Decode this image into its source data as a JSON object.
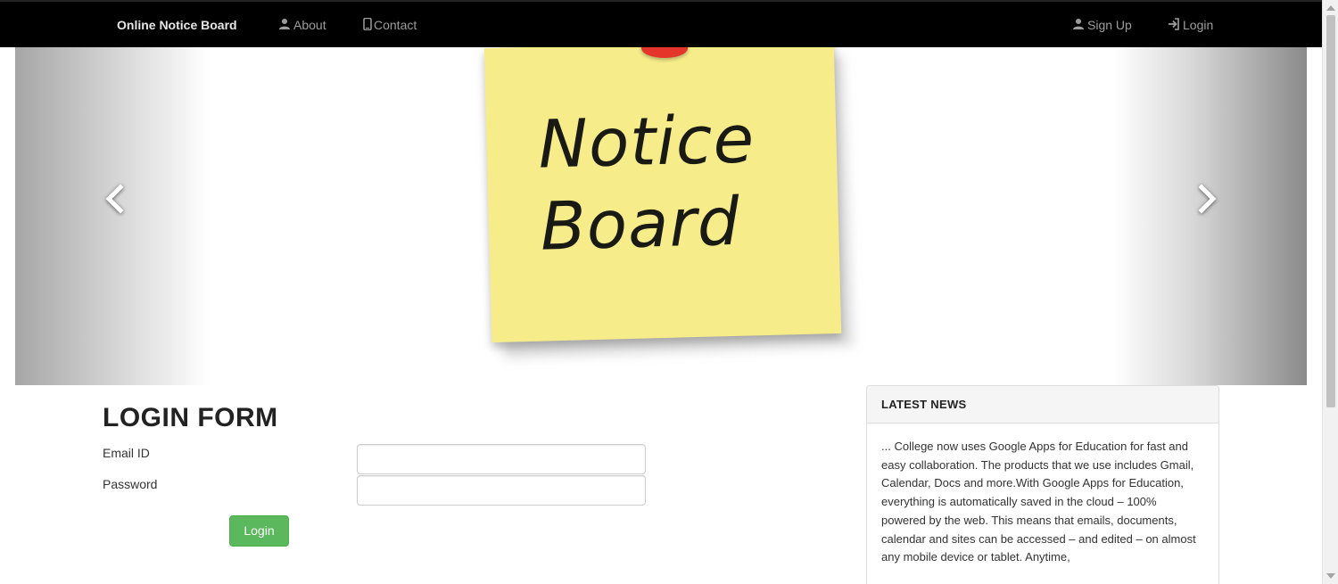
{
  "navbar": {
    "brand": "Online Notice Board",
    "about_label": "About",
    "contact_label": "Contact",
    "signup_label": "Sign Up",
    "login_label": "Login",
    "icons": {
      "about": "user-icon",
      "contact": "mobile-phone-icon",
      "signup": "user-icon",
      "login": "log-in-icon"
    }
  },
  "carousel": {
    "sticky_line1": "Notice",
    "sticky_line2": "Board",
    "prev_icon": "chevron-left-icon",
    "next_icon": "chevron-right-icon",
    "note_color": "#f7ec8a",
    "pin_color": "#e5342a"
  },
  "login_form": {
    "title": "LOGIN FORM",
    "email_label": "Email ID",
    "email_value": "",
    "password_label": "Password",
    "password_value": "",
    "submit_label": "Login",
    "submit_color": "#5cb85c"
  },
  "news": {
    "heading": "LATEST NEWS",
    "body": "... College now uses Google Apps for Education for fast and easy collaboration. The products that we use includes Gmail, Calendar, Docs and more.With Google Apps for Education, everything is automatically saved in the cloud – 100% powered by the web. This means that emails, documents, calendar and sites can be accessed – and edited – on almost any mobile device or tablet. Anytime,"
  }
}
